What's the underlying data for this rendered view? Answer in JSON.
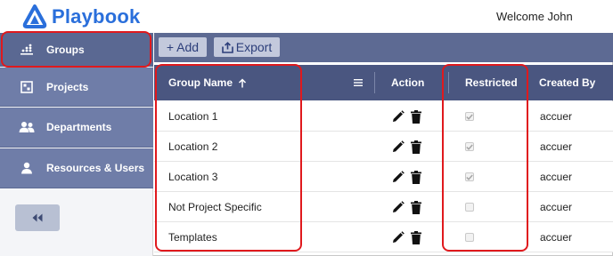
{
  "app": {
    "brand_name": "Playbook",
    "welcome_text": "Welcome John",
    "brand_color": "#2a6fdb"
  },
  "sidebar": {
    "items": [
      {
        "label": "Groups",
        "icon": "groups-icon",
        "active": true
      },
      {
        "label": "Projects",
        "icon": "projects-icon",
        "active": false
      },
      {
        "label": "Departments",
        "icon": "departments-icon",
        "active": false
      },
      {
        "label": "Resources & Users",
        "icon": "user-icon",
        "active": false
      }
    ],
    "collapse_icon": "double-chevron-left-icon"
  },
  "toolbar": {
    "add_label": "+ Add",
    "export_label": "Export"
  },
  "table": {
    "columns": {
      "group_name": "Group Name",
      "action": "Action",
      "restricted": "Restricted",
      "created_by": "Created By"
    },
    "sort": {
      "column": "group_name",
      "direction": "ascending"
    },
    "rows": [
      {
        "group_name": "Location 1",
        "restricted": true,
        "created_by": "accuer"
      },
      {
        "group_name": "Location 2",
        "restricted": true,
        "created_by": "accuer"
      },
      {
        "group_name": "Location 3",
        "restricted": true,
        "created_by": "accuer"
      },
      {
        "group_name": "Not Project Specific",
        "restricted": false,
        "created_by": "accuer"
      },
      {
        "group_name": "Templates",
        "restricted": false,
        "created_by": "accuer"
      }
    ]
  },
  "colors": {
    "sidebar_item": "#6f7da8",
    "toolbar": "#5d6a93",
    "table_header": "#4a5680",
    "highlight": "#e0191d"
  }
}
